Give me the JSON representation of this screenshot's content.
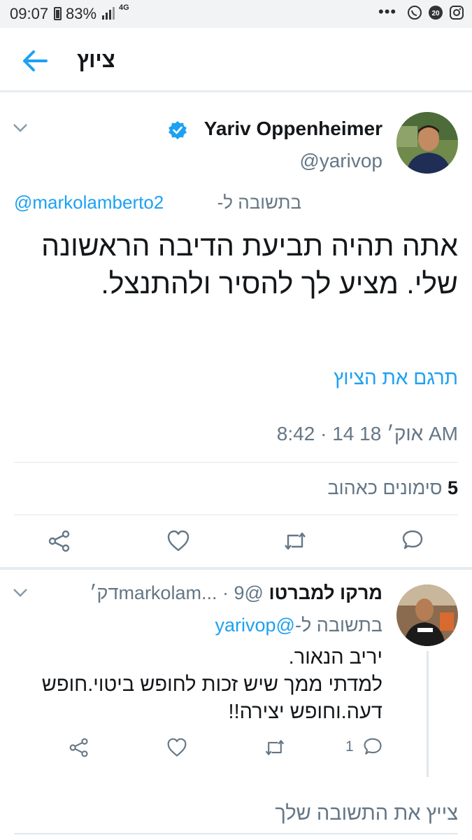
{
  "status_bar": {
    "time": "09:07",
    "battery": "83%",
    "network": "4G",
    "overflow": "•••",
    "icons": [
      "battery-icon",
      "signal-icon",
      "whatsapp-icon",
      "notification-count-icon",
      "instagram-icon"
    ],
    "notification_badge": "20"
  },
  "header": {
    "title": "ציוץ",
    "back_icon": "back-arrow-icon"
  },
  "tweet": {
    "author_name": "Yariv Oppenheimer",
    "author_handle": "@yarivop",
    "verified": true,
    "reply_to_prefix": "בתשובה ל-",
    "reply_to_handle": "@markolamberto2",
    "text": "אתה תהיה תביעת הדיבה הראשונה שלי. מציע לך להסיר ולהתנצל.",
    "translate_label": "תרגם את הציוץ",
    "timestamp": "אוק׳ 18 14 · 8:42 AM",
    "likes_count": "5",
    "likes_label": "סימונים כאהוב",
    "actions": [
      "reply-icon",
      "retweet-icon",
      "like-icon",
      "share-icon"
    ]
  },
  "reply": {
    "author_name": "מרקו למברטו",
    "author_handle": "@markolam...",
    "time_ago": "9דק׳",
    "reply_to_prefix": "בתשובה ל-",
    "reply_to_handle": "@yarivop",
    "text": "יריב הנאור.\nלמדתי ממך שיש זכות לחופש ביטוי.חופש דעה.וחופש יצירה!!",
    "reply_count": "1",
    "actions": [
      "reply-icon",
      "retweet-icon",
      "like-icon",
      "share-icon"
    ]
  },
  "compose": {
    "placeholder": "צייץ את התשובה שלך"
  },
  "colors": {
    "accent": "#1da1f2",
    "text": "#14171a",
    "secondary": "#657786",
    "divider": "#e1e8ed"
  }
}
